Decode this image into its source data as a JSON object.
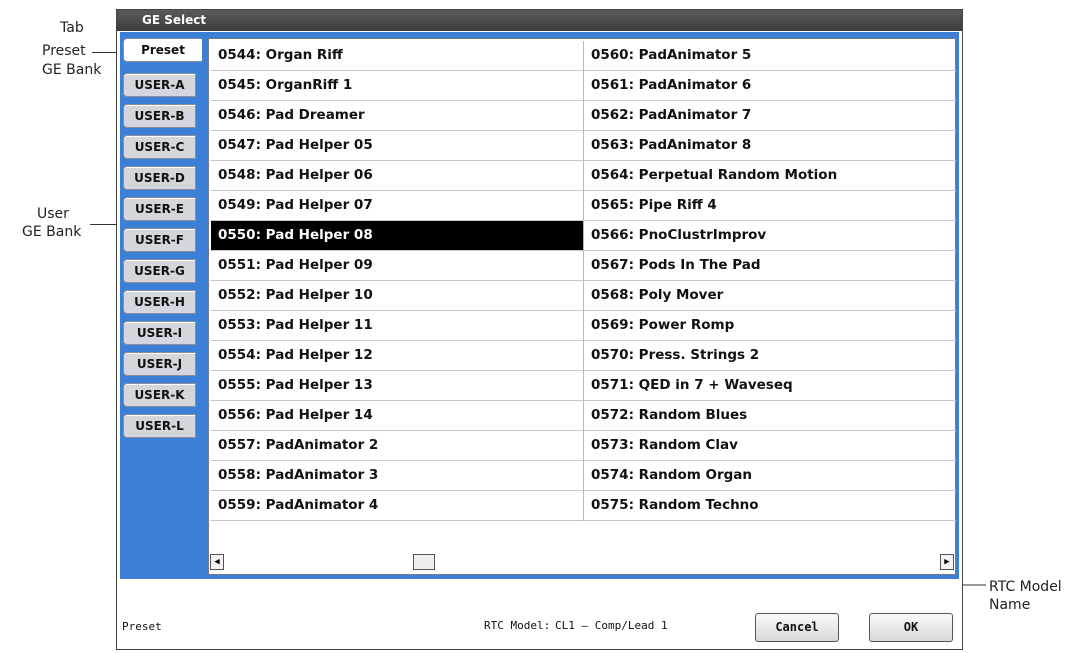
{
  "annotations": {
    "tab": "Tab",
    "preset_bank_line1": "Preset",
    "preset_bank_line2": "GE Bank",
    "user_bank_line1": "User",
    "user_bank_line2": "GE Bank",
    "rtc_line1": "RTC Model",
    "rtc_line2": "Name"
  },
  "dialog": {
    "title": "GE Select",
    "tabs": [
      "Preset",
      "USER-A",
      "USER-B",
      "USER-C",
      "USER-D",
      "USER-E",
      "USER-F",
      "USER-G",
      "USER-H",
      "USER-I",
      "USER-J",
      "USER-K",
      "USER-L"
    ],
    "active_tab": "Preset",
    "list_left": [
      "0544: Organ Riff",
      "0545: OrganRiff 1",
      "0546: Pad Dreamer",
      "0547: Pad Helper 05",
      "0548: Pad Helper 06",
      "0549: Pad Helper 07",
      "0550: Pad Helper 08",
      "0551: Pad Helper 09",
      "0552: Pad Helper 10",
      "0553: Pad Helper 11",
      "0554: Pad Helper 12",
      "0555: Pad Helper 13",
      "0556: Pad Helper 14",
      "0557: PadAnimator 2",
      "0558: PadAnimator 3",
      "0559: PadAnimator 4"
    ],
    "list_right": [
      "0560: PadAnimator 5",
      "0561: PadAnimator 6",
      "0562: PadAnimator 7",
      "0563: PadAnimator 8",
      "0564: Perpetual Random Motion",
      "0565: Pipe Riff 4",
      "0566: PnoClustrImprov",
      "0567: Pods In The Pad",
      "0568: Poly Mover",
      "0569: Power Romp",
      "0570: Press. Strings 2",
      "0571: QED in 7 + Waveseq",
      "0572: Random Blues",
      "0573: Random Clav",
      "0574: Random Organ",
      "0575: Random Techno"
    ],
    "selected_item": "0550: Pad Helper 08",
    "footer": {
      "bank_label": "Preset",
      "rtc_label": "RTC Model:",
      "rtc_value": "CL1 – Comp/Lead 1",
      "cancel": "Cancel",
      "ok": "OK"
    },
    "scroll_left_icon": "arrow-left-icon",
    "scroll_right_icon": "arrow-right-icon"
  }
}
